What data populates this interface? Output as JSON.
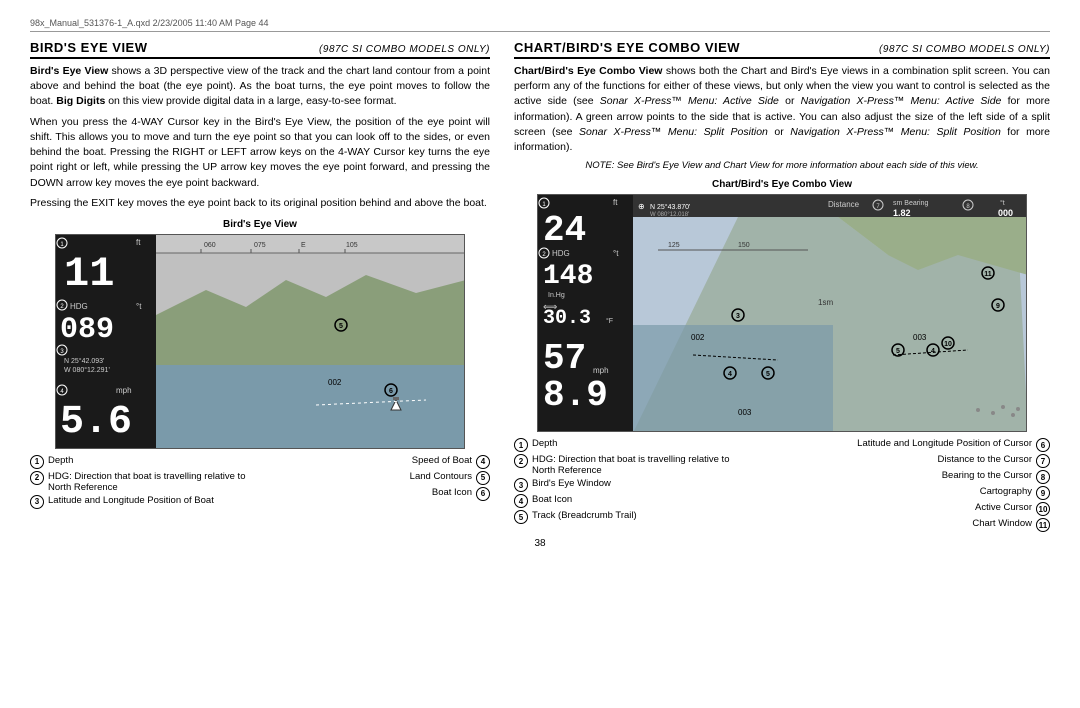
{
  "header": {
    "text": "98x_Manual_531376-1_A.qxd   2/23/2005   11:40 AM   Page 44"
  },
  "left_section": {
    "title": "BIRD'S EYE VIEW",
    "subtitle": "(987c SI Combo models only)",
    "diagram_title": "Bird's Eye View",
    "paragraphs": [
      "Bird's Eye View shows a 3D perspective view of the track and the chart land contour from a point above and behind the boat (the eye point). As the boat turns, the eye point moves to follow the boat. Big Digits on this view provide digital data in a large, easy-to-see format.",
      "When you press the 4-WAY Cursor key in the Bird's Eye View, the position of the eye point will shift. This allows you to move and turn the eye point so that you can look off to the sides, or even behind the boat. Pressing the RIGHT or LEFT arrow keys on the 4-WAY Cursor key turns the eye point right or left, while pressing the UP arrow key moves the eye point forward, and pressing the DOWN arrow key moves the eye point backward.",
      "Pressing the EXIT key moves the eye point back to its original position behind and above the boat."
    ],
    "diagram": {
      "data_values": {
        "depth": "11",
        "depth_unit": "ft",
        "hdg_label": "HDG",
        "hdg_unit": "°t",
        "hdg_value": "089",
        "position": "N 25°42.093'\nW 080°12.291'",
        "speed_label": "mph",
        "speed_value": "5.6",
        "ruler_marks": "060  075  E  105"
      }
    },
    "legend": [
      {
        "num": "1",
        "text": "Depth",
        "right": false
      },
      {
        "num": "2",
        "text": "HDG: Direction that boat is travelling relative to North Reference",
        "right": false
      },
      {
        "num": "3",
        "text": "Latitude and Longitude Position of Boat",
        "right": false
      },
      {
        "num": "4",
        "text": "Speed of Boat",
        "right": true
      },
      {
        "num": "5",
        "text": "Land Contours",
        "right": true
      },
      {
        "num": "6",
        "text": "Boat Icon",
        "right": true
      }
    ]
  },
  "right_section": {
    "title": "CHART/BIRD'S EYE COMBO VIEW",
    "subtitle": "(987c SI Combo models only)",
    "note": "NOTE: See Bird's Eye View and Chart View for more information about each side of this view.",
    "diagram_title": "Chart/Bird's Eye Combo View",
    "paragraphs": [
      "Chart/Bird's Eye Combo View shows both the Chart and Bird's Eye views in a combination split screen. You can perform any of the functions for either of these views, but only when the view you want to control is selected as the active side (see Sonar X-Press™ Menu: Active Side or Navigation X-Press™ Menu: Active Side for more information). A green arrow points to the side that is active. You can also adjust the size of the left side of a split screen (see Sonar X-Press™ Menu: Split Position or Navigation X-Press™ Menu: Split Position for more information)."
    ],
    "diagram": {
      "depth": "24",
      "hdg_value": "148",
      "pressure": "30.3",
      "speed": "8.9",
      "coords": "N 25°43.870'\nW 080°12.018'",
      "distance": "Distance",
      "bearing_val": "1.82",
      "bearing_label": "sm Bearing",
      "000_val": "000",
      "sm_val": "1sm"
    },
    "legend": [
      {
        "num": "1",
        "text": "Depth",
        "right": false
      },
      {
        "num": "2",
        "text": "HDG: Direction that boat is travelling relative to North Reference",
        "right": false
      },
      {
        "num": "3",
        "text": "Bird's Eye Window",
        "right": false
      },
      {
        "num": "4",
        "text": "Boat Icon",
        "right": false
      },
      {
        "num": "5",
        "text": "Track (Breadcrumb Trail)",
        "right": false
      },
      {
        "num": "6",
        "text": "Latitude and Longitude Position of Cursor",
        "right": true
      },
      {
        "num": "7",
        "text": "Distance to the Cursor",
        "right": true
      },
      {
        "num": "8",
        "text": "Bearing to the Cursor",
        "right": true
      },
      {
        "num": "9",
        "text": "Cartography",
        "right": true
      },
      {
        "num": "10",
        "text": "Active Cursor",
        "right": true
      },
      {
        "num": "11",
        "text": "Chart Window",
        "right": true
      }
    ]
  },
  "page_number": "38"
}
